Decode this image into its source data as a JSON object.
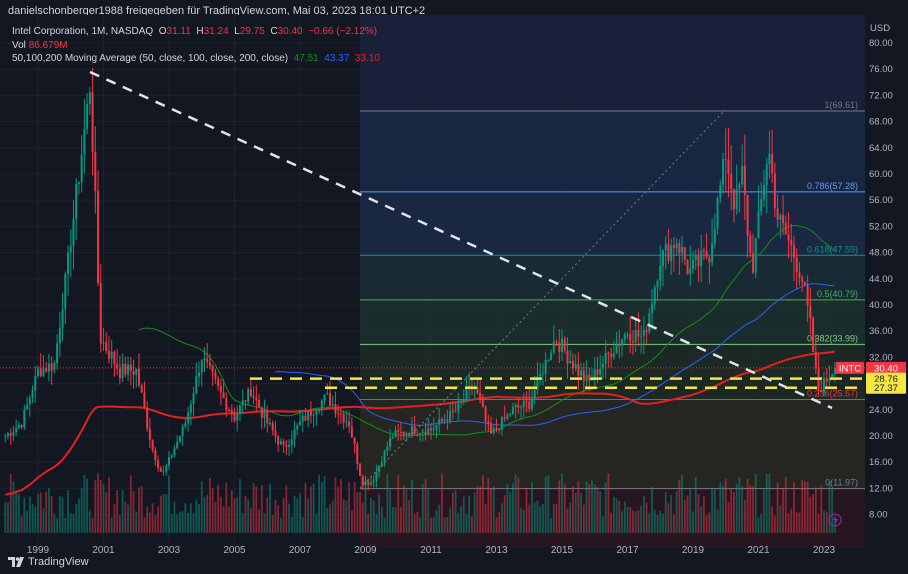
{
  "header": {
    "text": "danielschonberger1988 freigegeben für TradingView.com, Mai 03, 2023 18:01 UTC+2"
  },
  "legend": {
    "symbol": "Intel Corporation, 1M, NASDAQ",
    "open_label": "O",
    "open": "31.11",
    "high_label": "H",
    "high": "31.24",
    "low_label": "L",
    "low": "29.75",
    "close_label": "C",
    "close": "30.40",
    "change": "−0.66 (−2.12%)",
    "vol_label": "Vol",
    "vol": "86.679M",
    "ma_label": "50,100,200 Moving Average (50, close, 100, close, 200, close)",
    "ma50": "47.51",
    "ma100": "43.37",
    "ma200": "33.10"
  },
  "colors": {
    "up": "#089981",
    "down": "#f23645",
    "ma50": "#1b8a1b",
    "ma100": "#2962ff",
    "ma200": "#e52020",
    "support": "#f5e642"
  },
  "axis": {
    "currency": "USD",
    "price_ticks": [
      "80.00",
      "76.00",
      "72.00",
      "68.00",
      "64.00",
      "60.00",
      "56.00",
      "52.00",
      "48.00",
      "44.00",
      "40.00",
      "36.00",
      "32.00",
      "28.00",
      "24.00",
      "20.00",
      "16.00",
      "12.00",
      "8.00"
    ],
    "years": [
      "1999",
      "2001",
      "2003",
      "2005",
      "2007",
      "2009",
      "2011",
      "2013",
      "2015",
      "2017",
      "2019",
      "2021",
      "2023"
    ],
    "scale": "linear"
  },
  "price_labels": {
    "symbol": "INTC",
    "last": "30.40",
    "support1": "28.76",
    "support2": "27.37"
  },
  "fib": [
    {
      "label": "1(69.61)",
      "value": 69.61
    },
    {
      "label": "0.786(57.28)",
      "value": 57.28
    },
    {
      "label": "0.618(47.59)",
      "value": 47.59
    },
    {
      "label": "0.5(40.79)",
      "value": 40.79
    },
    {
      "label": "0.382(33.99)",
      "value": 33.99
    },
    {
      "label": "0.236(25.57)",
      "value": 25.57
    },
    {
      "label": "0(11.97)",
      "value": 11.97
    }
  ],
  "price_path": [
    [
      1998.0,
      20
    ],
    [
      1998.5,
      22
    ],
    [
      1999.0,
      30
    ],
    [
      1999.5,
      31
    ],
    [
      2000.0,
      50
    ],
    [
      2000.6,
      74
    ],
    [
      2000.9,
      35
    ],
    [
      2001.5,
      30
    ],
    [
      2002.0,
      30
    ],
    [
      2002.5,
      18
    ],
    [
      2002.8,
      14
    ],
    [
      2003.5,
      22
    ],
    [
      2004.0,
      32
    ],
    [
      2004.5,
      27
    ],
    [
      2005.0,
      23
    ],
    [
      2005.5,
      27
    ],
    [
      2006.0,
      22
    ],
    [
      2006.5,
      18
    ],
    [
      2007.0,
      22
    ],
    [
      2007.8,
      26
    ],
    [
      2008.5,
      22
    ],
    [
      2008.9,
      13
    ],
    [
      2009.2,
      13
    ],
    [
      2009.8,
      20
    ],
    [
      2010.5,
      21
    ],
    [
      2011.0,
      21
    ],
    [
      2011.8,
      24
    ],
    [
      2012.3,
      28
    ],
    [
      2012.8,
      20
    ],
    [
      2013.5,
      24
    ],
    [
      2014.0,
      25
    ],
    [
      2014.8,
      35
    ],
    [
      2015.5,
      30
    ],
    [
      2015.8,
      28
    ],
    [
      2016.5,
      33
    ],
    [
      2017.0,
      36
    ],
    [
      2017.5,
      35
    ],
    [
      2018.0,
      47
    ],
    [
      2018.5,
      50
    ],
    [
      2018.9,
      45
    ],
    [
      2019.5,
      48
    ],
    [
      2020.0,
      63
    ],
    [
      2020.3,
      55
    ],
    [
      2020.5,
      60
    ],
    [
      2020.8,
      45
    ],
    [
      2021.3,
      64
    ],
    [
      2021.6,
      53
    ],
    [
      2021.9,
      50
    ],
    [
      2022.3,
      45
    ],
    [
      2022.6,
      36
    ],
    [
      2022.8,
      27
    ],
    [
      2023.0,
      28
    ],
    [
      2023.3,
      30.4
    ]
  ],
  "footer": {
    "brand": "TradingView"
  }
}
